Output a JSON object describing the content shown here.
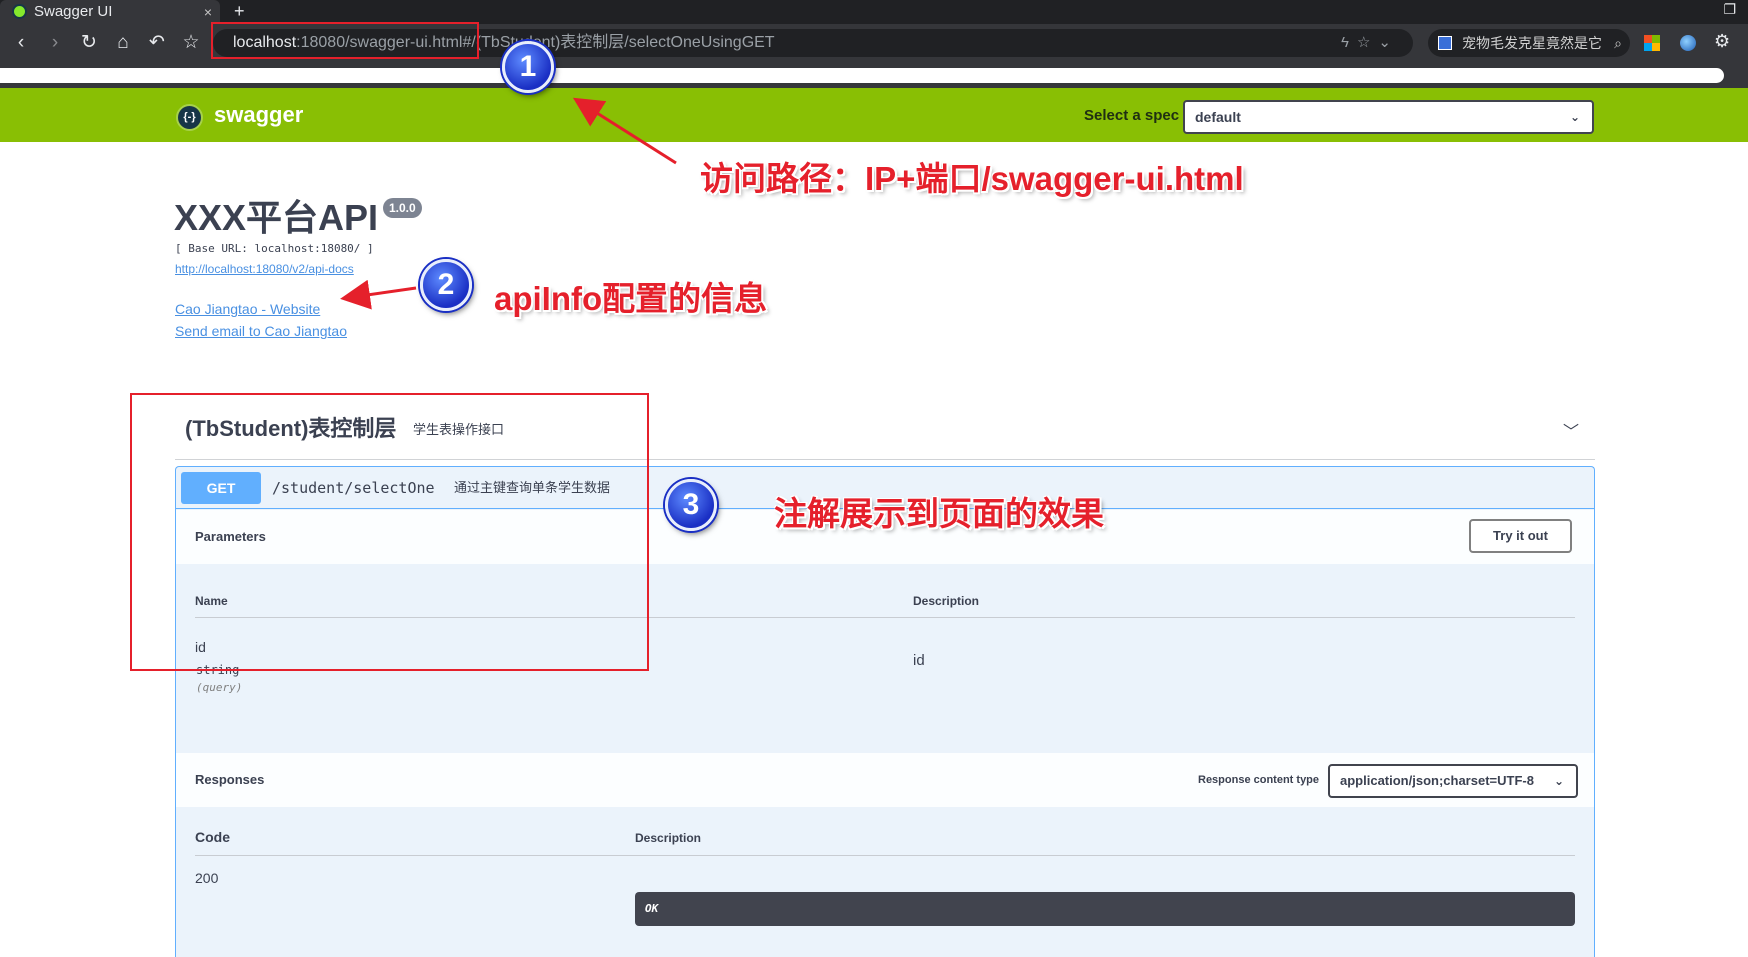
{
  "browser": {
    "tab_title": "Swagger UI",
    "tab_close": "×",
    "new_tab": "+",
    "url_host": "localhost",
    "url_rest": ":18080/swagger-ui.html#/(TbStudent)表控制层/selectOneUsingGET",
    "search_text": "宠物毛发克星竟然是它",
    "icons": [
      "back-icon",
      "forward-icon",
      "reload-icon",
      "home-icon",
      "undo-icon",
      "star-icon",
      "lightning-icon",
      "search-icon",
      "gear-icon"
    ]
  },
  "swagger_topbar": {
    "brand": "swagger",
    "logo_glyph": "{-}",
    "select_spec_label": "Select a spec",
    "spec_value": "default",
    "color": "#89bf04"
  },
  "info": {
    "title": "XXX平台API",
    "version": "1.0.0",
    "base_url": "[ Base URL: localhost:18080/ ]",
    "api_docs_link": "http://localhost:18080/v2/api-docs",
    "contact_website": "Cao Jiangtao - Website",
    "contact_email": "Send email to Cao Jiangtao"
  },
  "tag": {
    "name": "(TbStudent)表控制层",
    "description": "学生表操作接口"
  },
  "operation": {
    "method": "GET",
    "path": "/student/selectOne",
    "description": "通过主键查询单条学生数据",
    "method_color": "#61affe",
    "parameters_title": "Parameters",
    "try_it_out": "Try it out",
    "param_headers": {
      "name": "Name",
      "description": "Description"
    },
    "parameters": [
      {
        "name": "id",
        "type": "string",
        "in": "(query)",
        "description": "id"
      }
    ],
    "responses_title": "Responses",
    "response_content_type_label": "Response content type",
    "response_content_type": "application/json;charset=UTF-8",
    "response_headers": {
      "code": "Code",
      "description": "Description"
    },
    "responses": [
      {
        "code": "200",
        "description": "OK"
      }
    ]
  },
  "annotations": {
    "badge1": "1",
    "badge2": "2",
    "badge3": "3",
    "note1": "访问路径：IP+端口/swagger-ui.html",
    "note2": "apiInfo配置的信息",
    "note3": "注解展示到页面的效果",
    "color": "#e5202b"
  }
}
